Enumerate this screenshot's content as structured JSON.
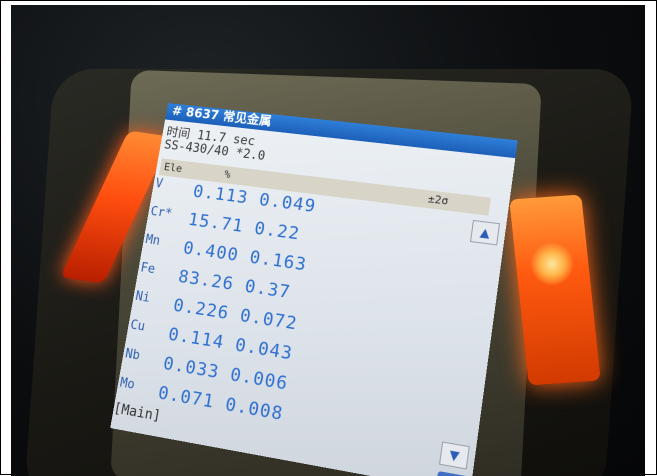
{
  "photo": {
    "screen_title": "# 8637 常见金属",
    "time_label": "时间 11.7 sec",
    "grade_label": "SS-430/40 *2.0",
    "table_header": {
      "ele": "Ele",
      "pct": "%",
      "sigma": "±2σ"
    },
    "rows": [
      {
        "el": "V",
        "values": "0.113 0.049"
      },
      {
        "el": "Cr*",
        "values": "15.71 0.22"
      },
      {
        "el": "Mn",
        "values": "0.400 0.163"
      },
      {
        "el": "Fe",
        "values": "83.26 0.37"
      },
      {
        "el": "Ni",
        "values": "0.226 0.072"
      },
      {
        "el": "Cu",
        "values": "0.114 0.043"
      },
      {
        "el": "Nb",
        "values": "0.033 0.006"
      },
      {
        "el": "Mo",
        "values": "0.071 0.008"
      }
    ],
    "main_label": "[Main]",
    "scroll_up": "▲",
    "scroll_down": "▼",
    "colors": {
      "led": "#ff5a10",
      "title_bar": "#1d5fb8",
      "values": "#2e6fd0"
    }
  }
}
